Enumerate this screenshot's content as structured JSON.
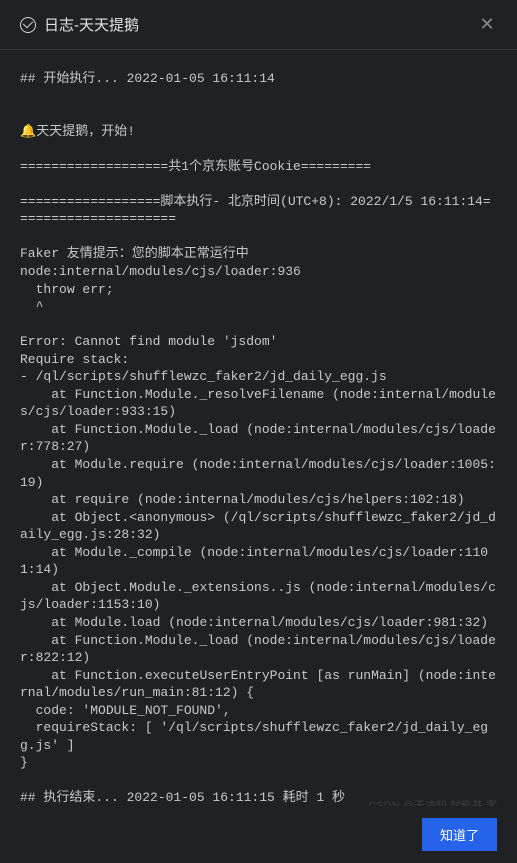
{
  "header": {
    "title": "日志-天天提鹅"
  },
  "log": {
    "start": "## 开始执行... 2022-01-05 16:11:14",
    "bell": "🔔",
    "startMsg": "天天提鹅，开始!",
    "sep1": "===================共1个京东账号Cookie=========",
    "sep2": "==================脚本执行- 北京时间(UTC+8): 2022/1/5 16:11:14=====================",
    "hint": "Faker 友情提示：您的脚本正常运行中",
    "node1": "node:internal/modules/cjs/loader:936",
    "throw": "  throw err;",
    "caret": "  ^",
    "err": "Error: Cannot find module 'jsdom'",
    "req": "Require stack:",
    "stack0": "- /ql/scripts/shufflewzc_faker2/jd_daily_egg.js",
    "stack1": "    at Function.Module._resolveFilename (node:internal/modules/cjs/loader:933:15)",
    "stack2": "    at Function.Module._load (node:internal/modules/cjs/loader:778:27)",
    "stack3": "    at Module.require (node:internal/modules/cjs/loader:1005:19)",
    "stack4": "    at require (node:internal/modules/cjs/helpers:102:18)",
    "stack5": "    at Object.<anonymous> (/ql/scripts/shufflewzc_faker2/jd_daily_egg.js:28:32)",
    "stack6": "    at Module._compile (node:internal/modules/cjs/loader:1101:14)",
    "stack7": "    at Object.Module._extensions..js (node:internal/modules/cjs/loader:1153:10)",
    "stack8": "    at Module.load (node:internal/modules/cjs/loader:981:32)",
    "stack9": "    at Function.Module._load (node:internal/modules/cjs/loader:822:12)",
    "stack10": "    at Function.executeUserEntryPoint [as runMain] (node:internal/modules/run_main:81:12) {",
    "code": "  code: 'MODULE_NOT_FOUND',",
    "reqstack": "  requireStack: [ '/ql/scripts/shufflewzc_faker2/jd_daily_egg.js' ]",
    "brace": "}",
    "end": "## 执行结束... 2022-01-05 16:11:15 耗时 1 秒"
  },
  "footer": {
    "button": "知道了"
  },
  "watermark": "CSDN @天冲知 封熊基 客"
}
